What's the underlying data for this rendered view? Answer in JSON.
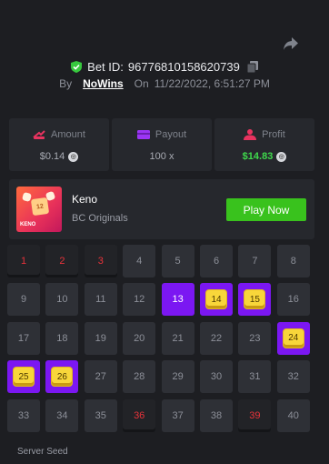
{
  "bet": {
    "id_label": "Bet ID:",
    "id_value": "96776810158620739",
    "by_label": "By",
    "user": "NoWins",
    "on_label": "On",
    "timestamp": "11/22/2022, 6:51:27 PM"
  },
  "stats": {
    "amount": {
      "label": "Amount",
      "value": "$0.14"
    },
    "payout": {
      "label": "Payout",
      "value": "100 x"
    },
    "profit": {
      "label": "Profit",
      "value": "$14.83"
    }
  },
  "game": {
    "thumb_label": "KENO",
    "thumb_number": "12",
    "name": "Keno",
    "provider": "BC Originals",
    "play_label": "Play Now"
  },
  "grid": {
    "numbers": [
      "1",
      "2",
      "3",
      "4",
      "5",
      "6",
      "7",
      "8",
      "9",
      "10",
      "11",
      "12",
      "13",
      "14",
      "15",
      "16",
      "17",
      "18",
      "19",
      "20",
      "21",
      "22",
      "23",
      "24",
      "25",
      "26",
      "27",
      "28",
      "29",
      "30",
      "31",
      "32",
      "33",
      "34",
      "35",
      "36",
      "37",
      "38",
      "39",
      "40"
    ],
    "drawn_miss": [
      1,
      2,
      3,
      36,
      39
    ],
    "selected_only": [
      13
    ],
    "hits": [
      14,
      15,
      24,
      25,
      26
    ]
  },
  "footer": {
    "seed_label": "Server Seed"
  },
  "colors": {
    "accent": "#7b17f2",
    "play": "#39c21d",
    "profit": "#3fd94c",
    "miss": "#e8333a",
    "gem": "#f8d63a"
  },
  "icons": {
    "share": "share-icon",
    "shield": "shield-check-icon",
    "copy": "copy-icon",
    "amount": "coins-icon",
    "payout": "wallet-icon",
    "profit": "user-coin-icon"
  }
}
